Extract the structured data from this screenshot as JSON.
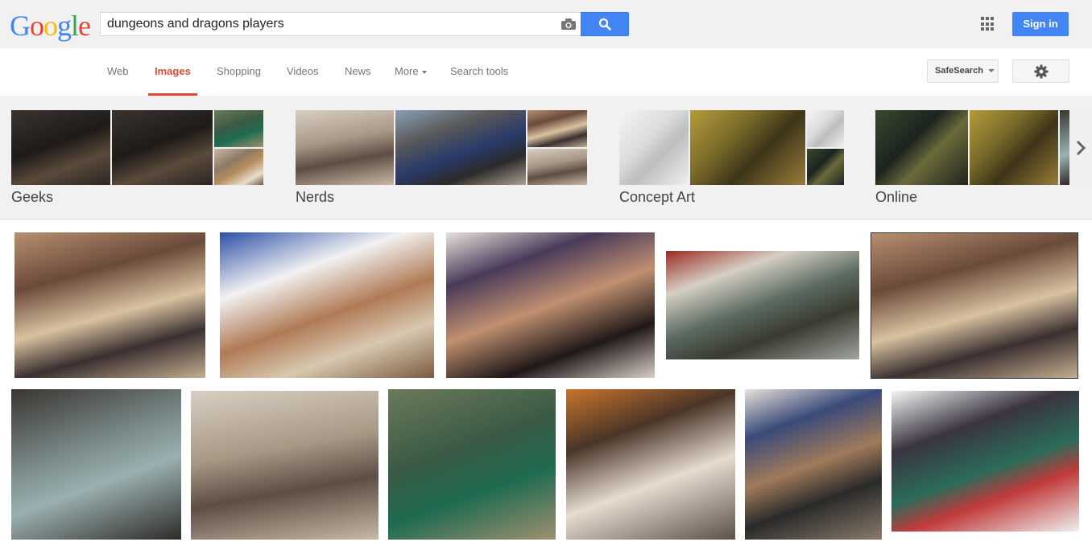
{
  "logo": {
    "letters": [
      "G",
      "o",
      "o",
      "g",
      "l",
      "e"
    ],
    "colors": [
      "#4285f4",
      "#ea4335",
      "#fbbc05",
      "#4285f4",
      "#34a853",
      "#ea4335"
    ]
  },
  "search": {
    "query": "dungeons and dragons players"
  },
  "header": {
    "signin_label": "Sign in"
  },
  "nav": {
    "tabs": [
      "Web",
      "Images",
      "Shopping",
      "Videos",
      "News",
      "More",
      "Search tools"
    ],
    "safesearch_label": "SafeSearch"
  },
  "categories": [
    {
      "label": "Geeks"
    },
    {
      "label": "Nerds"
    },
    {
      "label": "Concept Art"
    },
    {
      "label": "Online"
    }
  ],
  "colors": {
    "accent": "#dd4b39",
    "button_blue": "#4285f4",
    "header_bg": "#f1f1f1"
  }
}
